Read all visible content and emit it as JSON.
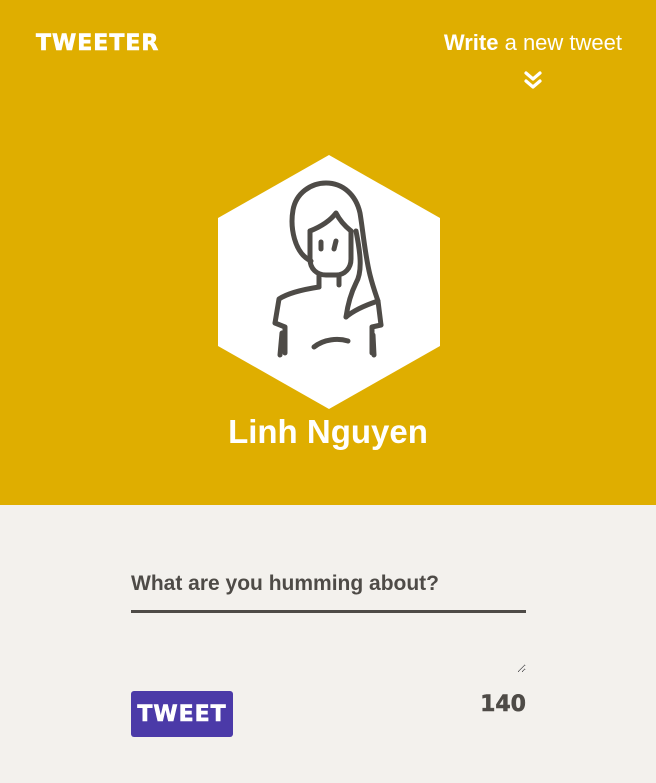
{
  "app": {
    "logo": "TWEETER"
  },
  "header": {
    "compose_strong": "Write",
    "compose_rest": " a new tweet",
    "chevron_icon": "chevrons-down-icon"
  },
  "profile": {
    "name": "Linh Nguyen",
    "avatar_icon": "woman-avatar-icon"
  },
  "composer": {
    "label": "What are you humming about?",
    "value": "",
    "submit_label": "TWEET",
    "char_count": "140"
  },
  "colors": {
    "header_bg": "#dfae00",
    "page_bg": "#f3f1ed",
    "text_dark": "#4e4b47",
    "button_bg": "#4b3aa8",
    "white": "#ffffff"
  }
}
